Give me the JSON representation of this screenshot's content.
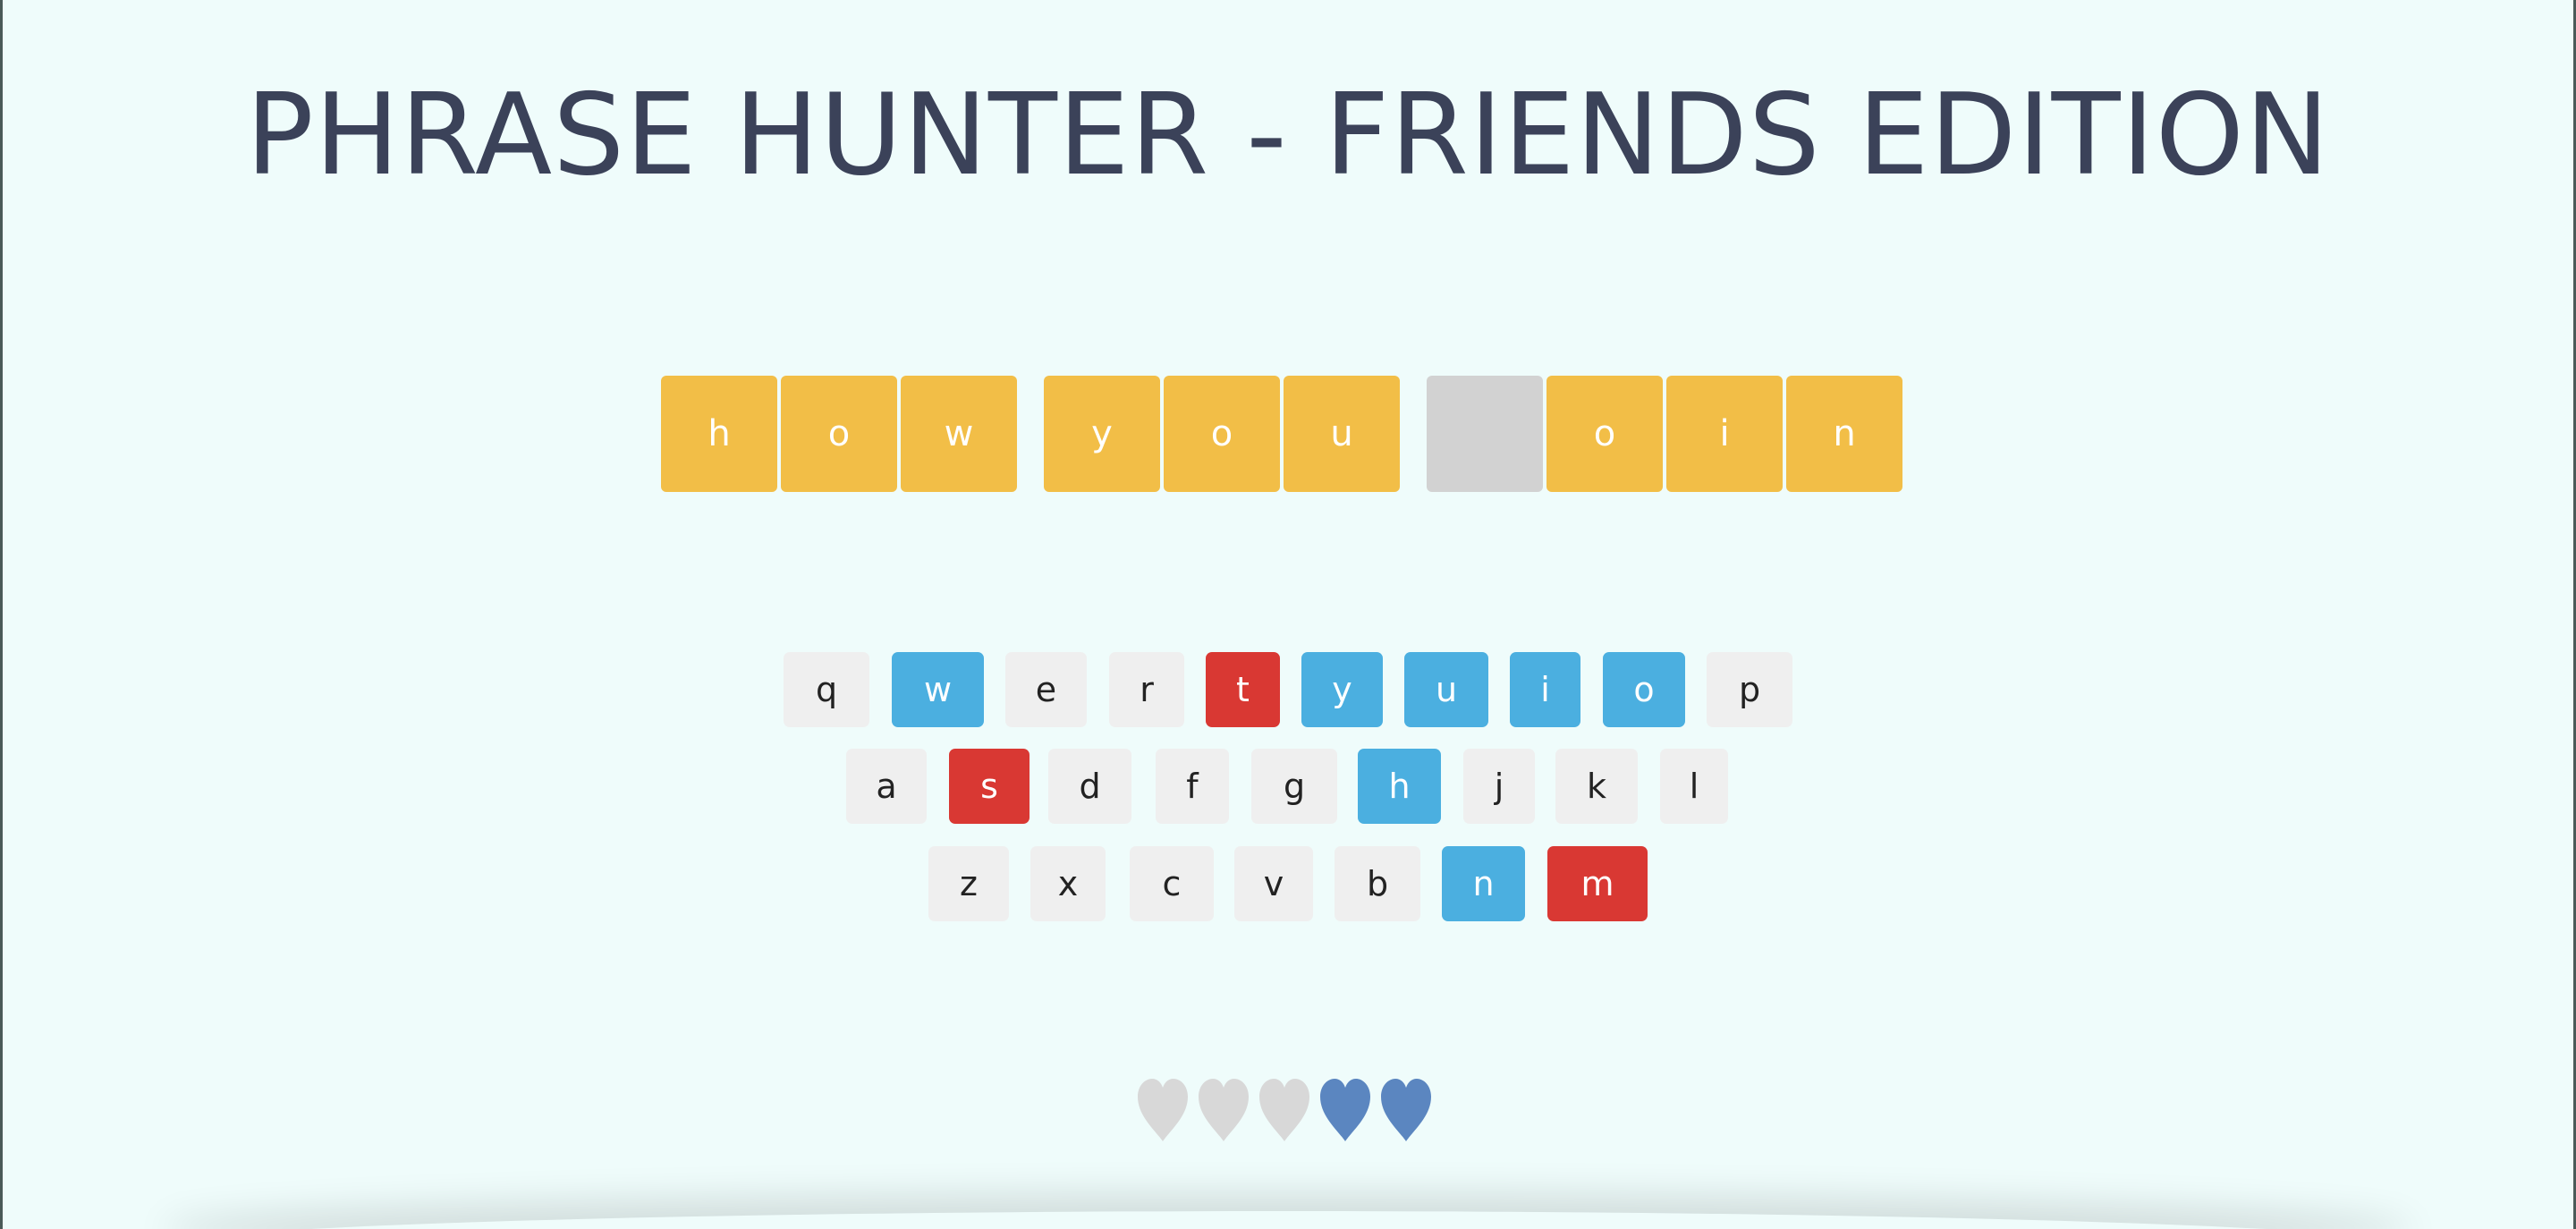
{
  "header": {
    "title": "PHRASE HUNTER - FRIENDS EDITION"
  },
  "phrase": {
    "words": [
      [
        {
          "char": "h",
          "shown": true
        },
        {
          "char": "o",
          "shown": true
        },
        {
          "char": "w",
          "shown": true
        }
      ],
      [
        {
          "char": "y",
          "shown": true
        },
        {
          "char": "o",
          "shown": true
        },
        {
          "char": "u",
          "shown": true
        }
      ],
      [
        {
          "char": "",
          "shown": false
        },
        {
          "char": "o",
          "shown": true
        },
        {
          "char": "i",
          "shown": true
        },
        {
          "char": "n",
          "shown": true
        }
      ]
    ]
  },
  "keyboard": {
    "rows": [
      [
        {
          "key": "q",
          "state": "unused"
        },
        {
          "key": "w",
          "state": "chosen"
        },
        {
          "key": "e",
          "state": "unused"
        },
        {
          "key": "r",
          "state": "unused"
        },
        {
          "key": "t",
          "state": "wrong"
        },
        {
          "key": "y",
          "state": "chosen"
        },
        {
          "key": "u",
          "state": "chosen"
        },
        {
          "key": "i",
          "state": "chosen"
        },
        {
          "key": "o",
          "state": "chosen"
        },
        {
          "key": "p",
          "state": "unused"
        }
      ],
      [
        {
          "key": "a",
          "state": "unused"
        },
        {
          "key": "s",
          "state": "wrong"
        },
        {
          "key": "d",
          "state": "unused"
        },
        {
          "key": "f",
          "state": "unused"
        },
        {
          "key": "g",
          "state": "unused"
        },
        {
          "key": "h",
          "state": "chosen"
        },
        {
          "key": "j",
          "state": "unused"
        },
        {
          "key": "k",
          "state": "unused"
        },
        {
          "key": "l",
          "state": "unused"
        }
      ],
      [
        {
          "key": "z",
          "state": "unused"
        },
        {
          "key": "x",
          "state": "unused"
        },
        {
          "key": "c",
          "state": "unused"
        },
        {
          "key": "v",
          "state": "unused"
        },
        {
          "key": "b",
          "state": "unused"
        },
        {
          "key": "n",
          "state": "chosen"
        },
        {
          "key": "m",
          "state": "wrong"
        }
      ]
    ]
  },
  "lives": {
    "total": 5,
    "remaining": 2,
    "lost_color": "#d8d8d8",
    "live_color": "#5b86c0"
  },
  "colors": {
    "background": "#effcfb",
    "title": "#3b4259",
    "letter_tile": "#f2be47",
    "hidden_tile": "#d2d2d2",
    "key_default": "#efefef",
    "key_chosen": "#4bafe0",
    "key_wrong": "#d93833"
  }
}
